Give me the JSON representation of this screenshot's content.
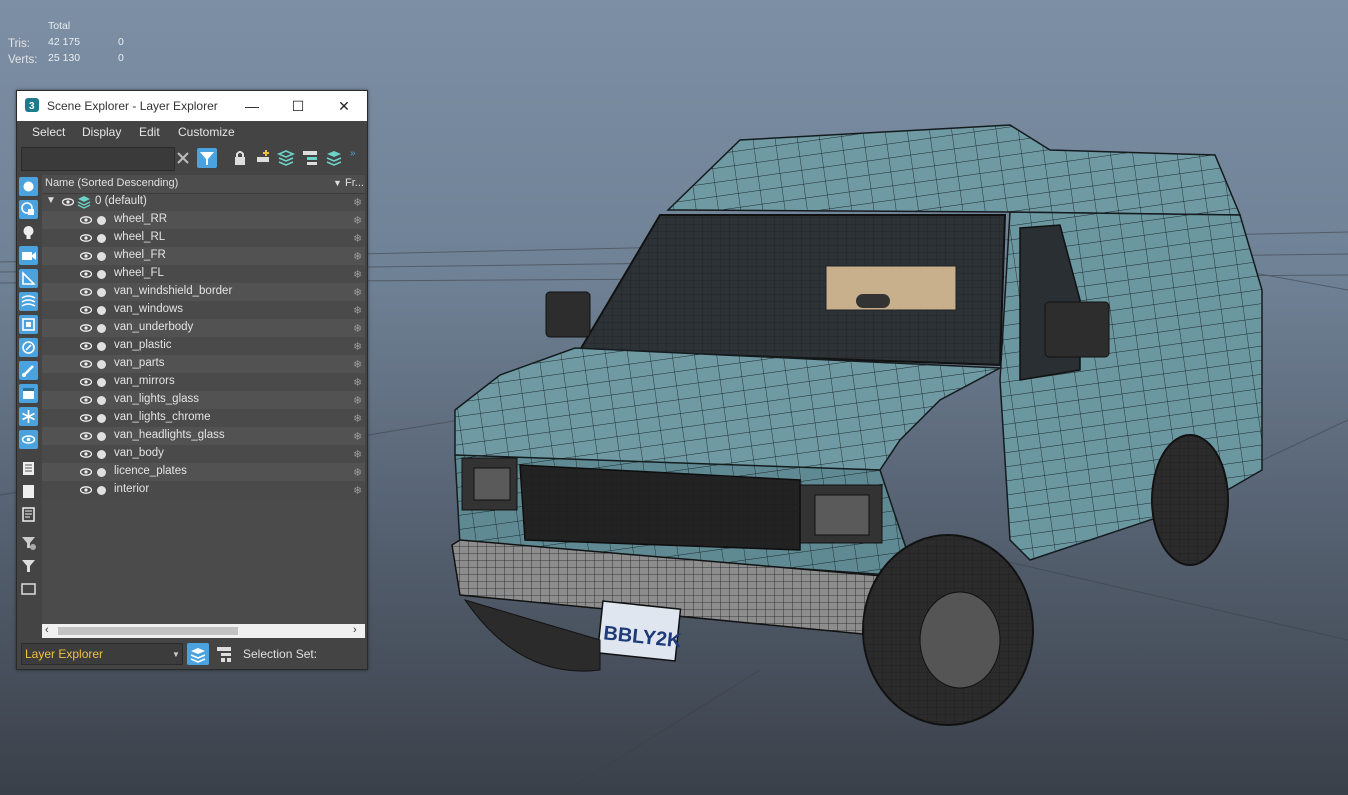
{
  "viewport_stats": {
    "header": "Total",
    "rows": [
      {
        "label": "Tris:",
        "value": "42 175",
        "selected": "0"
      },
      {
        "label": "Verts:",
        "value": "25 130",
        "selected": "0"
      }
    ]
  },
  "window": {
    "title": "Scene Explorer - Layer Explorer",
    "minimize": "—",
    "maximize": "☐",
    "close": "✕"
  },
  "menu": [
    "Select",
    "Display",
    "Edit",
    "Customize"
  ],
  "search": {
    "value": ""
  },
  "columns": {
    "name": "Name (Sorted Descending)",
    "frozen": "Fr..."
  },
  "root_layer": "0 (default)",
  "layers": [
    "wheel_RR",
    "wheel_RL",
    "wheel_FR",
    "wheel_FL",
    "van_windshield_border",
    "van_windows",
    "van_underbody",
    "van_plastic",
    "van_parts",
    "van_mirrors",
    "van_lights_glass",
    "van_lights_chrome",
    "van_headlights_glass",
    "van_body",
    "licence_plates",
    "interior"
  ],
  "bottom": {
    "explorer_type": "Layer Explorer",
    "selection_set_label": "Selection Set:"
  },
  "license_plate_text": "BBLY2K",
  "colors": {
    "accent": "#4aa3df",
    "van_body": "#6f9aa3",
    "wire": "#1b2327"
  }
}
